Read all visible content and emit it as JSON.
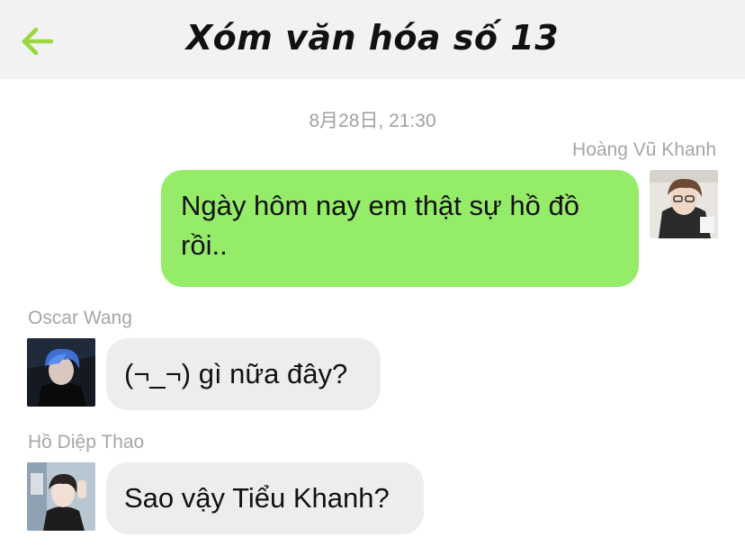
{
  "header": {
    "title": "Xóm văn hóa số 13",
    "back_icon": "arrow-left-icon",
    "accent_color": "#9bd73a"
  },
  "timestamp": "8月28日, 21:30",
  "messages": [
    {
      "sender": "Hoàng Vũ Khanh",
      "direction": "outgoing",
      "text": "Ngày hôm nay em thật sự hồ đồ rồi..",
      "bubble_color": "#95ec69"
    },
    {
      "sender": "Oscar Wang",
      "direction": "incoming",
      "text": "(¬_¬) gì nữa đây?",
      "bubble_color": "#ededed"
    },
    {
      "sender": "Hồ Diệp Thao",
      "direction": "incoming",
      "text": "Sao vậy Tiểu Khanh?",
      "bubble_color": "#ededed"
    }
  ]
}
